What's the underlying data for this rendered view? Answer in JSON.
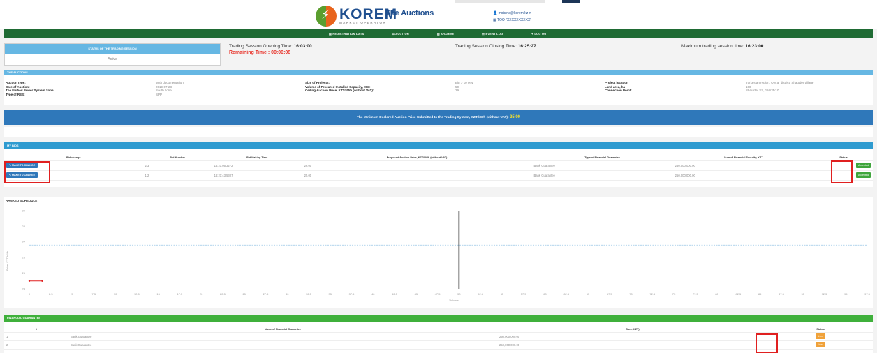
{
  "header": {
    "brand": "KOREM",
    "brand_sub": "MARKET OPERATOR",
    "app_title": "The Auctions",
    "user_email": "moisina@korem.kz ▾",
    "user_org": "TOO \"XXXXXXXXXX\""
  },
  "nav": [
    "REGISTRATION DATA",
    "AUCTION",
    "ARCHIVE",
    "EVENT LOG",
    "LOG OUT"
  ],
  "session": {
    "status_header": "STATUS OF THE TRADING SESSION",
    "status_value": "Active",
    "opening_label": "Trading Session Opening Time:",
    "opening_value": "16:03:00",
    "remaining_label": "Remaining Time :",
    "remaining_value": "00:00:08",
    "closing_label": "Trading Session Closing Time:",
    "closing_value": "16:25:27",
    "max_label": "Maximum trading session time:",
    "max_value": "16:23:00"
  },
  "auctions": {
    "header": "THE AUCTIONS",
    "col1": [
      {
        "label": "Auction type:",
        "value": "With documentation"
      },
      {
        "label": "Date of Auction:",
        "value": "2019-07-28"
      },
      {
        "label": "The Unified Power System Zone:",
        "value": "South zone"
      },
      {
        "label": "Type of RES:",
        "value": "SPP"
      }
    ],
    "col2": [
      {
        "label": "Size of Projects:",
        "value": "Big > 10 MW"
      },
      {
        "label": "Volume of Procured Installed Capacity, MW:",
        "value": "50"
      },
      {
        "label": "Ceiling Auction Price, KZT/kWh (without VAT):",
        "value": "29"
      }
    ],
    "col3": [
      {
        "label": "Project location",
        "value": "Turkestan region, Otyrar district, Shaulder village"
      },
      {
        "label": "Land area, ha",
        "value": "100"
      },
      {
        "label": "Connection Point:",
        "value": "Shaulder SS, 110/35/10"
      }
    ]
  },
  "min_price": {
    "text": "The Minimum Declared Auction Price Submitted to the Trading System, KZT/kWh (without VAT):",
    "value": "25.00"
  },
  "bids": {
    "header": "MY BIDS",
    "columns": [
      "Bid change",
      "Bid Number",
      "Bid Making Time",
      "Proposed Auction Price, KZT/kWh (without VAT)",
      "Type of Financial Guarantee",
      "Sum of Financial Security, KZT",
      "Status"
    ],
    "change_label": "MAKE TO CHANGE",
    "rows": [
      {
        "number": "2/3",
        "time": "16:21:05.3272",
        "price": "26.00",
        "guarantee": "Bank Guarantee",
        "sum": "250,000,000.00",
        "status": "Accepted"
      },
      {
        "number": "1/2",
        "time": "16:21:43.5307",
        "price": "25.00",
        "guarantee": "Bank Guarantee",
        "sum": "250,000,000.00",
        "status": "Accepted"
      }
    ]
  },
  "schedule": {
    "header": "RANKED SCHEDULE",
    "ylabel": "Price, KZT/kWh",
    "xlabel": "Volume"
  },
  "chart_data": {
    "type": "line",
    "title": "RANKED SCHEDULE",
    "xlabel": "Volume",
    "ylabel": "Price, KZT/kWh",
    "y_ticks": [
      "24",
      "25",
      "26",
      "27",
      "28",
      "29"
    ],
    "x_ticks": [
      "0",
      "2.5",
      "5",
      "7.5",
      "10",
      "12.5",
      "15",
      "17.5",
      "20",
      "22.5",
      "25",
      "27.5",
      "30",
      "32.5",
      "35",
      "37.5",
      "40",
      "42.5",
      "45",
      "47.5",
      "50",
      "52.5",
      "55",
      "57.5",
      "60",
      "62.5",
      "65",
      "67.5",
      "70",
      "72.5",
      "75",
      "77.5",
      "80",
      "82.5",
      "85",
      "87.5",
      "90",
      "92.5",
      "95",
      "97.5"
    ],
    "ylim": [
      24,
      29
    ],
    "xlim": [
      0,
      97.5
    ],
    "series": [
      {
        "values": [
          {
            "x": 0,
            "y": 24.5
          },
          {
            "x": 1.5,
            "y": 24.5
          }
        ]
      }
    ],
    "ceiling_price": 26.8,
    "volume_marker": 50,
    "grid": false
  },
  "guarantee": {
    "header": "FINANCIAL GUARANTEE",
    "columns": [
      "#",
      "Name of Financial Guarantee",
      "Sum (KZT)",
      "Status"
    ],
    "rows": [
      {
        "n": "1",
        "name": "Bank Guarantee",
        "sum": "250,000,000.00",
        "status": "Used"
      },
      {
        "n": "2",
        "name": "Bank Guarantee",
        "sum": "250,000,000.00",
        "status": "Used"
      }
    ]
  },
  "colors": {
    "nav": "#1f6b34",
    "info_header": "#66b7e3",
    "min_price_bg": "#2f78ba",
    "guarantee_header": "#3fb03b",
    "remaining": "#e8332a",
    "highlight": "#e02020"
  }
}
